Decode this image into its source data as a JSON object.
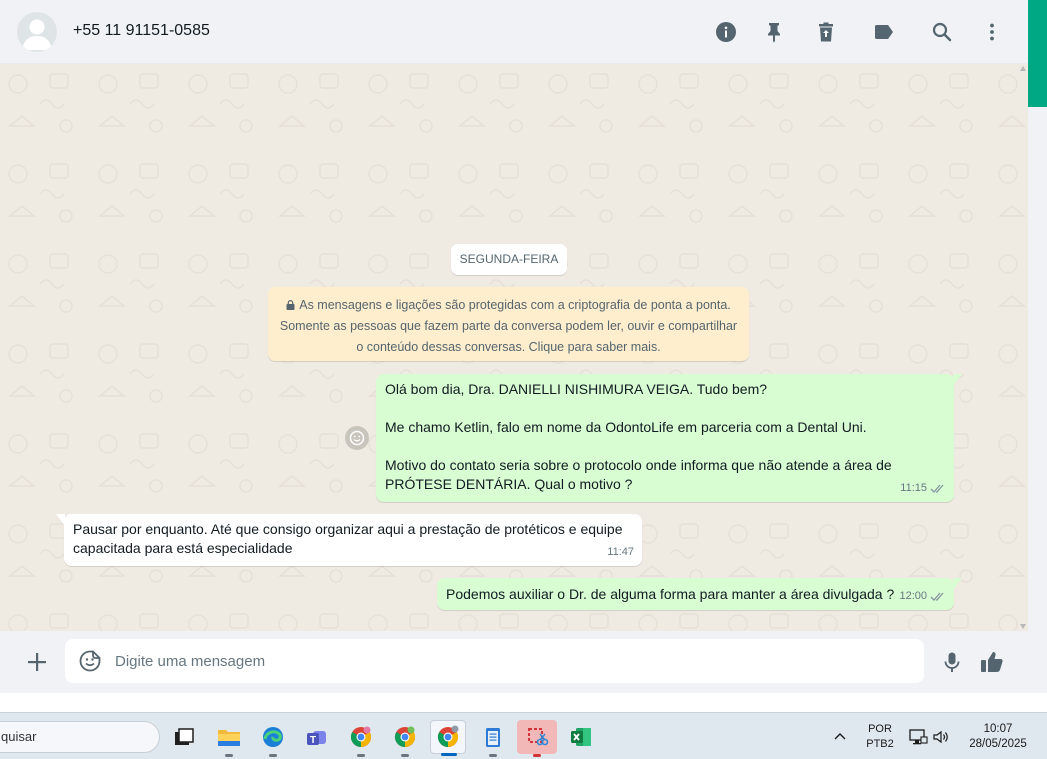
{
  "header": {
    "contact_name": "+55 11 91151-0585",
    "icons": [
      "info-icon",
      "pin-icon",
      "delete-icon",
      "label-icon",
      "search-icon",
      "menu-icon"
    ]
  },
  "chat": {
    "day_label": "SEGUNDA-FEIRA",
    "encryption_notice": {
      "line1": "As mensagens e ligações são protegidas com a criptografia de ponta a ponta.",
      "line2": "Somente as pessoas que fazem parte da conversa podem ler, ouvir e compartilhar",
      "line3": "o conteúdo dessas conversas. Clique para saber mais."
    },
    "messages": [
      {
        "direction": "out",
        "lines": [
          "Olá bom dia, Dra. DANIELLI NISHIMURA VEIGA. Tudo bem?",
          "",
          "Me chamo Ketlin, falo em nome da OdontoLife em parceria com a Dental Uni.",
          "",
          "Motivo do contato seria sobre o protocolo onde informa que não atende a área de",
          "PRÓTESE DENTÁRIA. Qual o motivo ?"
        ],
        "time": "11:15",
        "status": "read"
      },
      {
        "direction": "in",
        "lines": [
          "Pausar por enquanto. Até que consigo organizar aqui a prestação de protéticos e equipe",
          "capacitada para está especialidade"
        ],
        "time": "11:47"
      },
      {
        "direction": "out",
        "lines": [
          "Podemos auxiliar o Dr. de alguma forma para manter a área divulgada ?"
        ],
        "time": "12:00",
        "status": "read"
      }
    ]
  },
  "composer": {
    "placeholder": "Digite uma mensagem",
    "value": ""
  },
  "taskbar": {
    "search_text": "quisar",
    "apps": [
      "file-explorer",
      "edge",
      "teams",
      "chrome",
      "chrome",
      "chrome",
      "notepad",
      "snipping-tool",
      "excel"
    ],
    "language_line1": "POR",
    "language_line2": "PTB2",
    "time": "10:07",
    "date": "28/05/2025"
  },
  "colors": {
    "accent": "#00a884",
    "outgoing_bubble": "#d9fdd3",
    "incoming_bubble": "#ffffff",
    "chat_background": "#efeae2",
    "encryption_notice": "#ffeecd",
    "read_ticks": "#8696a0"
  }
}
